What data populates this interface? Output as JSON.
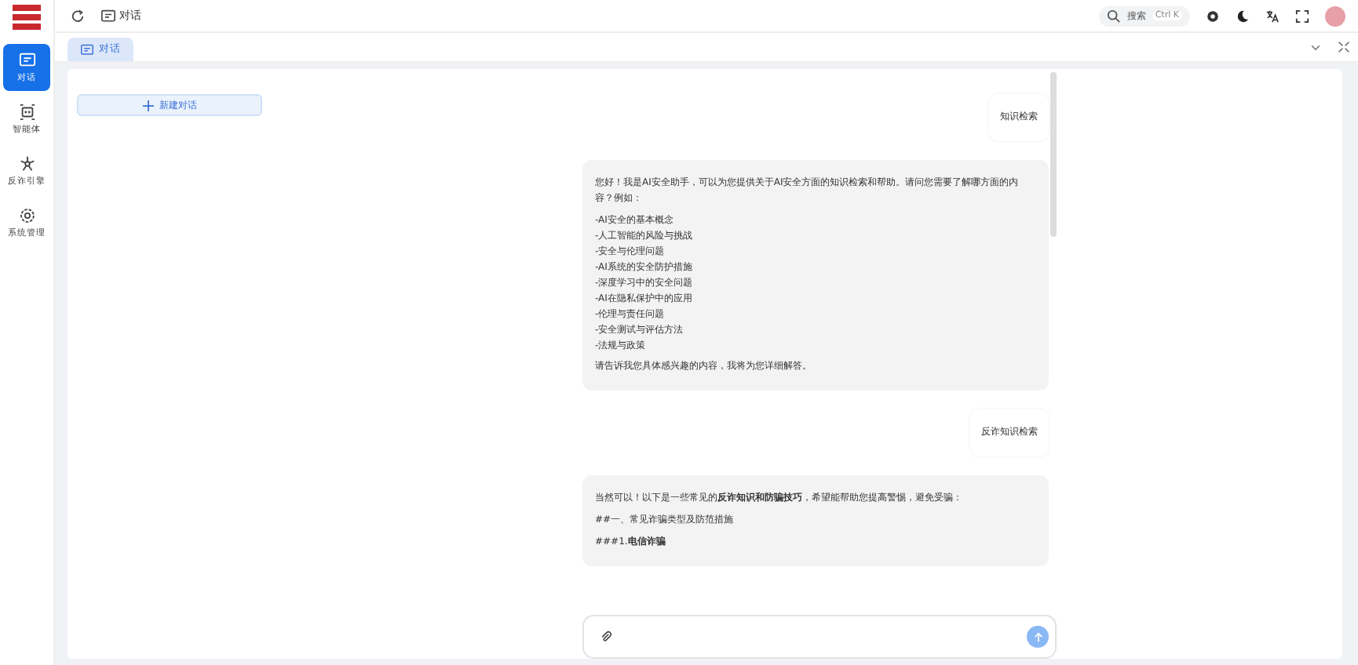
{
  "sidebar": {
    "items": [
      {
        "label": "对话",
        "selected": true,
        "kind": "chat"
      },
      {
        "label": "智能体",
        "selected": false,
        "kind": "agent"
      },
      {
        "label": "反诈引擎",
        "selected": false,
        "kind": "engine"
      },
      {
        "label": "系统管理",
        "selected": false,
        "kind": "gear"
      }
    ]
  },
  "header": {
    "breadcrumb": "对话",
    "search": {
      "placeholder": "搜索",
      "shortcut": "Ctrl K"
    }
  },
  "tabs": [
    {
      "label": "对话",
      "selected": true
    }
  ],
  "new_chat": "新建对话",
  "messages": [
    {
      "kind": "user",
      "text": "知识检索"
    },
    {
      "kind": "assistant",
      "paragraphs": [
        "您好！我是AI安全助手，可以为您提供关于AI安全方面的知识检索和帮助。请问您需要了解哪方面的内容？例如："
      ],
      "list": [
        "-AI安全的基本概念",
        "-人工智能的风险与挑战",
        "-安全与伦理问题",
        "-AI系统的安全防护措施",
        "-深度学习中的安全问题",
        "-AI在隐私保护中的应用",
        "-伦理与责任问题",
        "-安全测试与评估方法",
        "-法规与政策"
      ],
      "closing": "请告诉我您具体感兴趣的内容，我将为您详细解答。"
    },
    {
      "kind": "user",
      "text": "反诈知识检索"
    },
    {
      "kind": "assistant",
      "paragraphs": [
        "当然可以！以下是一些常见的**反诈知识和防骗技巧**，希望能帮助您提高警惕，避免受骗：",
        "##一、常见诈骗类型及防范措施",
        "###1.**电信诈骗**"
      ]
    }
  ]
}
